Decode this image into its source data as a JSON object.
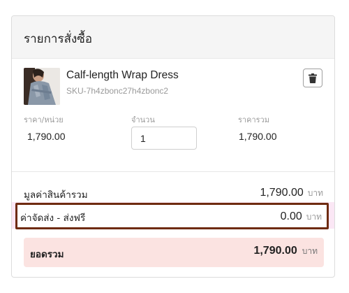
{
  "order": {
    "title": "รายการสั่งซื้อ",
    "item": {
      "name": "Calf-length Wrap Dress",
      "sku": "SKU-7h4zbonc27h4zbonc2",
      "thumbnail_icon": "product-photo-dress"
    },
    "columns": {
      "unit_price_label": "ราคา/หน่วย",
      "quantity_label": "จำนวน",
      "line_total_label": "ราคารวม"
    },
    "line": {
      "unit_price": "1,790.00",
      "quantity": "1",
      "line_total": "1,790.00"
    }
  },
  "summary": {
    "subtotal_label": "มูลค่าสินค้ารวม",
    "subtotal_value": "1,790.00",
    "shipping_label": "ค่าจัดส่ง - ส่งฟรี",
    "shipping_value": "0.00",
    "total_label": "ยอดรวม",
    "total_value": "1,790.00",
    "currency": "บาท"
  },
  "colors": {
    "highlight_border": "#6e2b10",
    "total_background": "#fbe3e1",
    "shipping_band": "#fbe7f5"
  }
}
